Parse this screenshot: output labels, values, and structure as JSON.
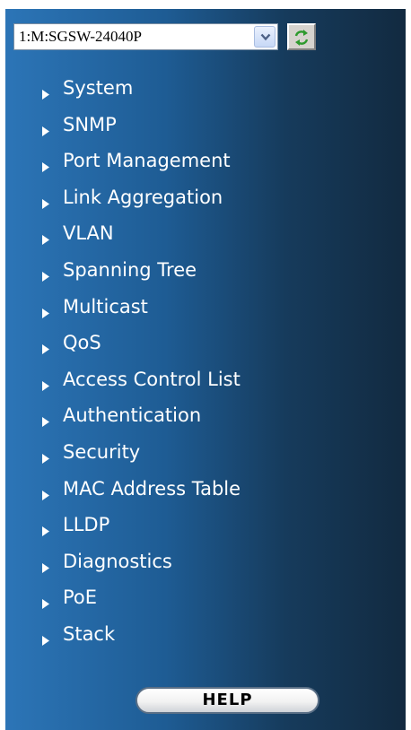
{
  "device_select": {
    "value": "1:M:SGSW-24040P",
    "arrow_icon": "chevron-down-icon"
  },
  "refresh_button": {
    "icon": "refresh-icon",
    "icon_color": "#2e9a2e"
  },
  "menu": {
    "items": [
      {
        "label": "System"
      },
      {
        "label": "SNMP"
      },
      {
        "label": "Port Management"
      },
      {
        "label": "Link Aggregation"
      },
      {
        "label": "VLAN"
      },
      {
        "label": "Spanning Tree"
      },
      {
        "label": "Multicast"
      },
      {
        "label": "QoS"
      },
      {
        "label": "Access Control List"
      },
      {
        "label": "Authentication"
      },
      {
        "label": "Security"
      },
      {
        "label": "MAC Address Table"
      },
      {
        "label": "LLDP"
      },
      {
        "label": "Diagnostics"
      },
      {
        "label": "PoE"
      },
      {
        "label": "Stack"
      }
    ],
    "bullet_icon": "triangle-right-icon"
  },
  "help_button": {
    "label": "HELP"
  },
  "colors": {
    "panel_gradient_left": "#2c75b7",
    "panel_gradient_right": "#122a40",
    "menu_text": "#ffffff"
  }
}
